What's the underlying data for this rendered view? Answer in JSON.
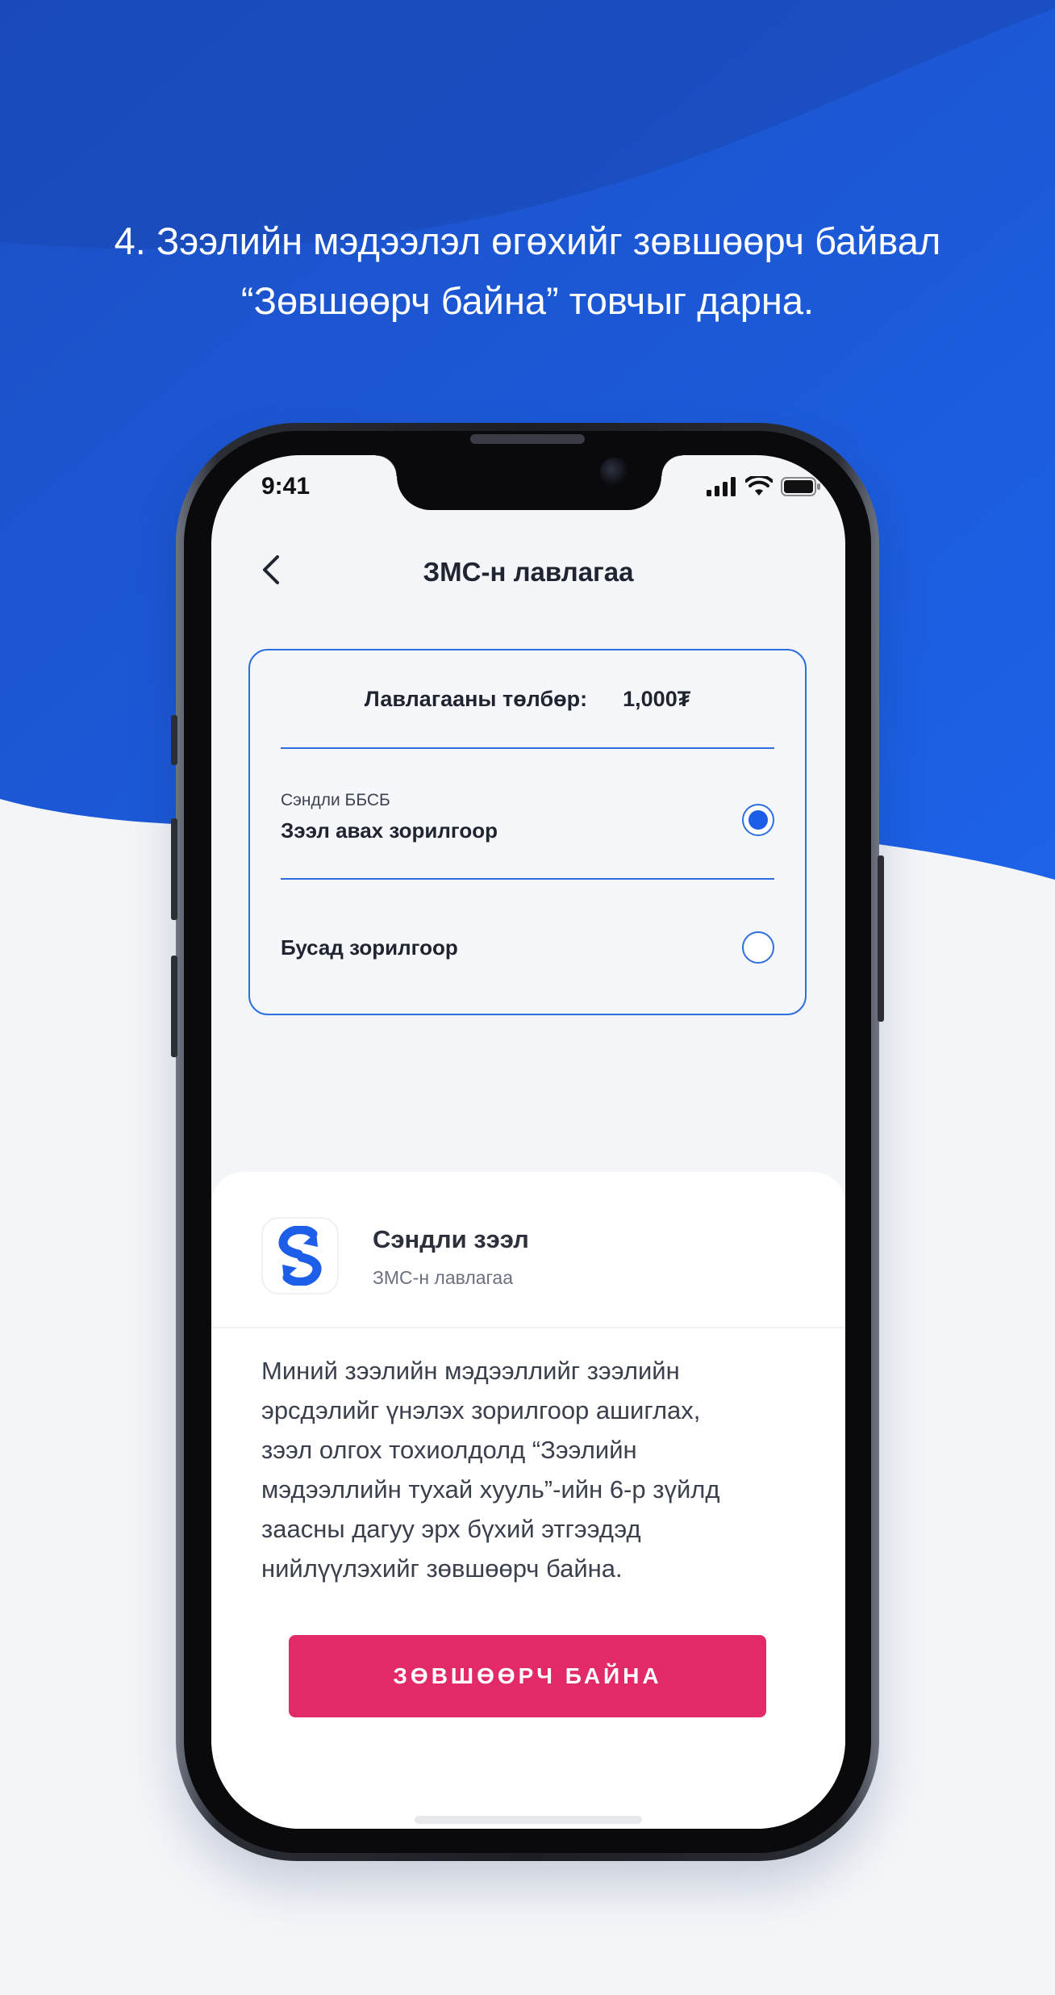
{
  "headline": {
    "line1": "4. Зээлийн мэдээлэл өгөхийг зөвшөөрч байвал",
    "line2": "“Зөвшөөрч байна” товчыг дарна."
  },
  "status_bar": {
    "time": "9:41",
    "icons": [
      "signal-icon",
      "wifi-icon",
      "battery-icon"
    ]
  },
  "nav": {
    "title": "ЗМС-н лавлагаа",
    "back_icon": "chevron-left-icon"
  },
  "fee": {
    "label": "Лавлагааны төлбөр:",
    "value": "1,000₮"
  },
  "options": [
    {
      "subtitle": "Сэндли ББСБ",
      "label": "Зээл авах зорилгоор",
      "selected": true
    },
    {
      "label": "Бусад зорилгоор",
      "selected": false
    }
  ],
  "sheet": {
    "app_name": "Сэндли зээл",
    "app_sub": "ЗМС-н лавлагаа",
    "consent_lines": [
      "Миний зээлийн мэдээллийг зээлийн",
      "эрсдэлийг үнэлэх зорилгоор ашиглах,",
      "зээл олгох тохиолдолд “Зээлийн",
      "мэдээллийн тухай хууль”-ийн 6-р зүйлд",
      "заасны дагуу эрх бүхий этгээдэд",
      "нийлүүлэхийг зөвшөөрч байна."
    ],
    "accept_label": "ЗӨВШӨӨРЧ БАЙНА"
  },
  "colors": {
    "brand_blue": "#1d5ee8",
    "accent_pink": "#e32a68",
    "background": "#f3f5f9"
  }
}
